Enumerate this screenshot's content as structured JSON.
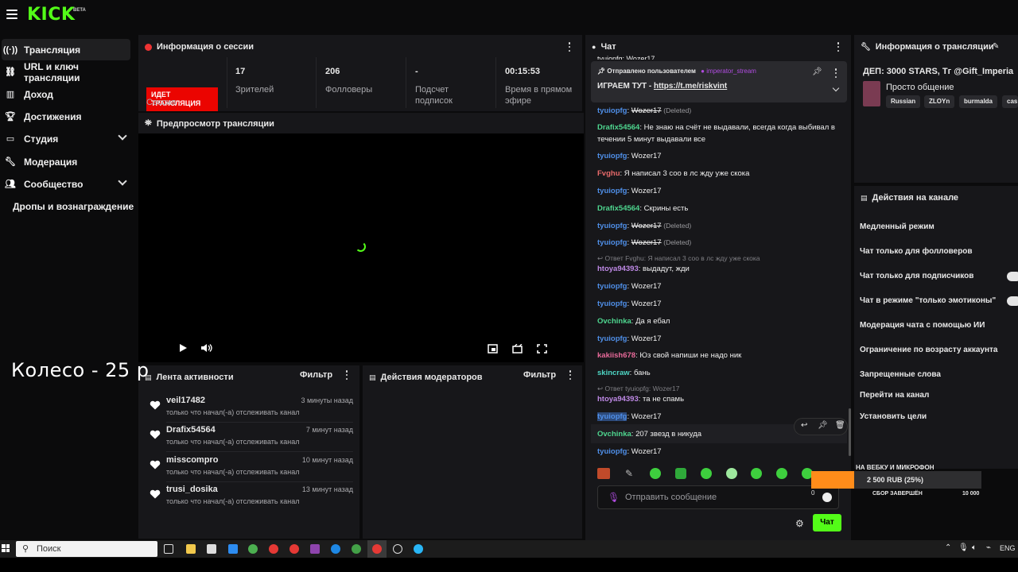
{
  "brand": {
    "logo": "KICK",
    "beta": "BETA"
  },
  "sidebar": {
    "items": [
      {
        "label": "Трансляция",
        "icon": "broadcast-icon"
      },
      {
        "label": "URL и ключ трансляции",
        "icon": "link-icon"
      },
      {
        "label": "Доход",
        "icon": "revenue-icon"
      },
      {
        "label": "Достижения",
        "icon": "trophy-icon"
      },
      {
        "label": "Студия",
        "icon": "studio-icon"
      },
      {
        "label": "Модерация",
        "icon": "wrench-icon"
      },
      {
        "label": "Сообщество",
        "icon": "community-icon"
      },
      {
        "label": "Дропы и вознаграждение"
      }
    ]
  },
  "session": {
    "title": "Информация о сессии",
    "badge": "ИДЕТ ТРАНСЛЯЦИЯ",
    "badge_label": "Сессия",
    "stats": [
      {
        "value": "17",
        "label": "Зрителей"
      },
      {
        "value": "206",
        "label": "Фолловеры"
      },
      {
        "value": "-",
        "label": "Подсчет подписок"
      },
      {
        "value": "00:15:53",
        "label": "Время в прямом эфире"
      }
    ]
  },
  "preview": {
    "title": "Предпросмотр трансляции"
  },
  "overlay_text": "Колесо - 25 р",
  "activity": {
    "title": "Лента активности",
    "filter": "Фильтр",
    "items": [
      {
        "name": "veil17482",
        "desc": "только что начал(-а) отслеживать канал",
        "time": "3 минуты назад"
      },
      {
        "name": "Drafix54564",
        "desc": "только что начал(-а) отслеживать канал",
        "time": "7 минут назад"
      },
      {
        "name": "misscompro",
        "desc": "только что начал(-а) отслеживать канал",
        "time": "10 минут назад"
      },
      {
        "name": "trusi_dosika",
        "desc": "только что начал(-а) отслеживать канал",
        "time": "13 минут назад"
      }
    ]
  },
  "mod_actions": {
    "title": "Действия модераторов",
    "filter": "Фильтр"
  },
  "chat": {
    "title": "Чат",
    "pinned": {
      "by": "Отправлено пользователем",
      "user": "imperator_stream",
      "text": "ИГРАЕМ ТУТ - ",
      "link": "https://t.me/riskvint"
    },
    "messages": [
      {
        "user": "tyuiopfg",
        "color": "#4f8fe8",
        "text": "Wozer17",
        "deleted": "(Deleted)",
        "strike": true
      },
      {
        "user": "Drafix54564",
        "color": "#4ed68f",
        "text": "Не знаю на счёт не выдавали, всегда когда выбивал в течении 5 минут выдавали все"
      },
      {
        "user": "tyuiopfg",
        "color": "#4f8fe8",
        "text": "Wozer17"
      },
      {
        "user": "Fvghu",
        "color": "#e86a6a",
        "text": "Я написал 3 соо в лс жду уже скока"
      },
      {
        "user": "tyuiopfg",
        "color": "#4f8fe8",
        "text": "Wozer17"
      },
      {
        "user": "Drafix54564",
        "color": "#4ed68f",
        "text": "Скрины есть"
      },
      {
        "user": "tyuiopfg",
        "color": "#4f8fe8",
        "text": "Wozer17",
        "deleted": "(Deleted)",
        "strike": true
      },
      {
        "user": "tyuiopfg",
        "color": "#4f8fe8",
        "text": "Wozer17",
        "deleted": "(Deleted)",
        "strike": true
      },
      {
        "reply": "Ответ Fvghu: Я написал 3 соо в лс жду уже скока",
        "user": "htoya94393",
        "color": "#c08ae8",
        "text": "выдадут, жди"
      },
      {
        "user": "tyuiopfg",
        "color": "#4f8fe8",
        "text": "Wozer17"
      },
      {
        "user": "tyuiopfg",
        "color": "#4f8fe8",
        "text": "Wozer17"
      },
      {
        "user": "Ovchinka",
        "color": "#4ed68f",
        "text": "Да я ебал"
      },
      {
        "user": "tyuiopfg",
        "color": "#4f8fe8",
        "text": "Wozer17"
      },
      {
        "user": "kakiish678",
        "color": "#e86a9a",
        "text": "Юз свой напиши не надо ник"
      },
      {
        "user": "skincraw",
        "color": "#4ed6c4",
        "text": "бань"
      },
      {
        "reply": "Ответ tyuiopfg: Wozer17",
        "user": "htoya94393",
        "color": "#c08ae8",
        "text": "та не спамь"
      },
      {
        "user": "tyuiopfg",
        "color": "#4f8fe8",
        "text": "Wozer17"
      },
      {
        "user": "Ovchinka",
        "color": "#4ed68f",
        "text": "207 звезд в никуда"
      },
      {
        "user": "tyuiopfg",
        "color": "#4f8fe8",
        "text": "Wozer17"
      }
    ],
    "top_cut": "tyuiopfg: Wozer17",
    "input_placeholder": "Отправить сообщение",
    "char_count": "0",
    "send_label": "Чат"
  },
  "stream_info": {
    "title": "Информация о трансляции",
    "stream_title": "ДЕП: 3000 STARS, Тг @Gift_Imperia",
    "category": "Просто общение",
    "tags": [
      "Russian",
      "ZLOYn",
      "burmalda",
      "cas"
    ]
  },
  "channel_actions": {
    "title": "Действия на канале",
    "options": [
      "Медленный режим",
      "Чат только для фолловеров",
      "Чат только для подписчиков",
      "Чат в режиме \"только эмотиконы\"",
      "Модерация чата с помощью ИИ",
      "Ограничение по возрасту аккаунта",
      "Запрещенные слова",
      "Перейти на канал",
      "Установить цели"
    ]
  },
  "goal": {
    "title": "НА ВЕБКУ И МИКРОФОН",
    "amount": "2 500 RUB (25%)",
    "status": "СБОР ЗАВЕРШЁН",
    "target": "10 000",
    "progress": 0.25
  },
  "taskbar": {
    "search": "Поиск",
    "lang": "ENG"
  }
}
